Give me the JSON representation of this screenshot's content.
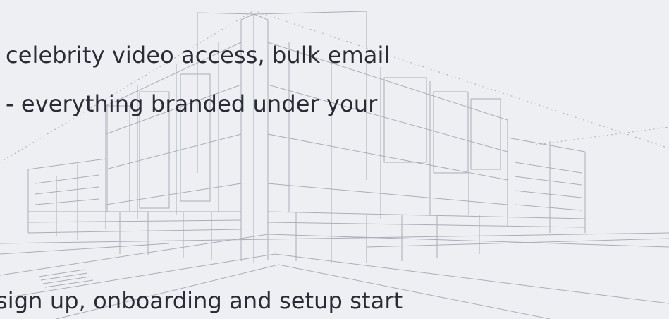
{
  "text_lines": [
    "celebrity video access, bulk email",
    "- everything branded under your",
    "sign up, onboarding and setup start"
  ],
  "colors": {
    "background": "#eeeff3",
    "text": "#2a2c35",
    "sketch_lines": "#9fa3ad"
  },
  "decor": {
    "background_illustration": "architectural-building-sketch"
  }
}
